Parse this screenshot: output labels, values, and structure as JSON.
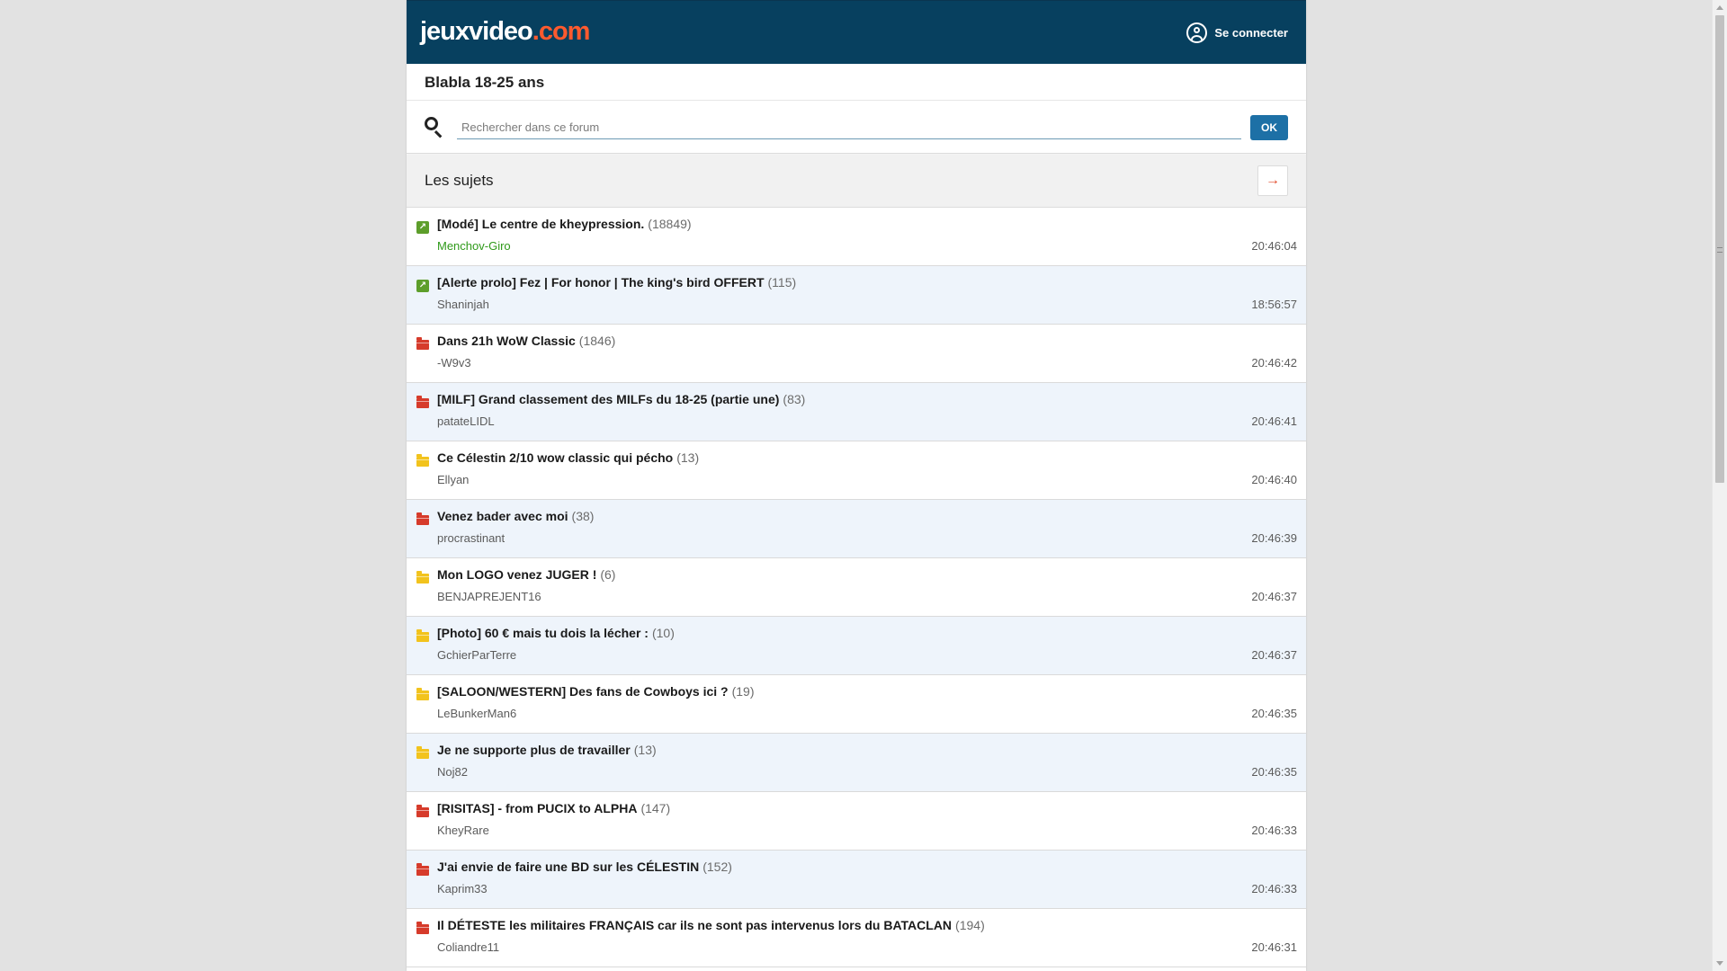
{
  "header": {
    "logo_main": "jeuxvideo",
    "logo_dot": ".com",
    "login_label": "Se connecter"
  },
  "forum": {
    "title": "Blabla 18-25 ans"
  },
  "search": {
    "placeholder": "Rechercher dans ce forum",
    "ok_label": "OK"
  },
  "subjects": {
    "title": "Les sujets",
    "arrow_icon": "arrow-right-icon"
  },
  "colors": {
    "topbar": "#07405f",
    "logo_accent": "#ff5a2e",
    "ok_button": "#1d70a6",
    "pin_icon": "#5d9e2b",
    "folder_hot": "#d63b2b",
    "folder_normal": "#f2c31d",
    "moderator_name": "#2f9a1a",
    "alt_row": "#eef4fb"
  },
  "topics": [
    {
      "icon": "pin-icon",
      "title": "[Modé] Le centre de kheypression.",
      "count": "(18849)",
      "author": "Menchov-Giro",
      "time": "20:46:04",
      "mod": true
    },
    {
      "icon": "pin-icon",
      "title": "[Alerte prolo] Fez | For honor | The king's bird OFFERT",
      "count": "(115)",
      "author": "Shaninjah",
      "time": "18:56:57",
      "mod": false
    },
    {
      "icon": "folder-red-icon",
      "title": "Dans 21h WoW Classic",
      "count": "(1846)",
      "author": "-W9v3",
      "time": "20:46:42",
      "mod": false
    },
    {
      "icon": "folder-red-icon",
      "title": "[MILF] Grand classement des MILFs du 18-25 (partie une)",
      "count": "(83)",
      "author": "patateLIDL",
      "time": "20:46:41",
      "mod": false
    },
    {
      "icon": "folder-yellow-icon",
      "title": "Ce Célestin 2/10 wow classic qui pécho",
      "count": "(13)",
      "author": "Ellyan",
      "time": "20:46:40",
      "mod": false
    },
    {
      "icon": "folder-red-icon",
      "title": "Venez bader avec moi",
      "count": "(38)",
      "author": "procrastinant",
      "time": "20:46:39",
      "mod": false
    },
    {
      "icon": "folder-yellow-icon",
      "title": "Mon LOGO venez JUGER !",
      "count": "(6)",
      "author": "BENJAPREJENT16",
      "time": "20:46:37",
      "mod": false
    },
    {
      "icon": "folder-yellow-icon",
      "title": "[Photo] 60 € mais tu dois la lécher :",
      "count": "(10)",
      "author": "GchierParTerre",
      "time": "20:46:37",
      "mod": false
    },
    {
      "icon": "folder-yellow-icon",
      "title": "[SALOON/WESTERN] Des fans de Cowboys ici ?",
      "count": "(19)",
      "author": "LeBunkerMan6",
      "time": "20:46:35",
      "mod": false
    },
    {
      "icon": "folder-yellow-icon",
      "title": "Je ne supporte plus de travailler",
      "count": "(13)",
      "author": "Noj82",
      "time": "20:46:35",
      "mod": false
    },
    {
      "icon": "folder-red-icon",
      "title": "[RISITAS] - from PUCIX to ALPHA",
      "count": "(147)",
      "author": "KheyRare",
      "time": "20:46:33",
      "mod": false
    },
    {
      "icon": "folder-red-icon",
      "title": "J'ai envie de faire une BD sur les CÉLESTIN",
      "count": "(152)",
      "author": "Kaprim33",
      "time": "20:46:33",
      "mod": false
    },
    {
      "icon": "folder-red-icon",
      "title": "Il DÉTESTE les militaires FRANÇAIS car ils ne sont pas intervenus lors du BATACLAN",
      "count": "(194)",
      "author": "Coliandre11",
      "time": "20:46:31",
      "mod": false
    }
  ]
}
